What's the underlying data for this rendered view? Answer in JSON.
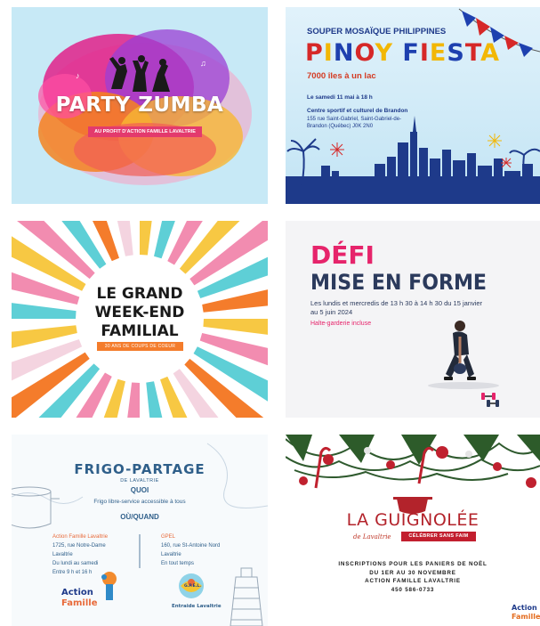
{
  "cards": {
    "party_zumba": {
      "title": "PARTY ZUMBA",
      "subtitle": "AU PROFIT D'ACTION FAMILLE LAVALTRIE"
    },
    "pinoy_fiesta": {
      "kicker": "SOUPER MOSAÏQUE PHILIPPINES",
      "title_letters": [
        "P",
        "I",
        "N",
        "O",
        "Y",
        " ",
        "F",
        "I",
        "E",
        "S",
        "T",
        "A"
      ],
      "title_colors": [
        "#d62828",
        "#f2b705",
        "#1e40af",
        "#d62828",
        "#f2b705",
        "#ffffff",
        "#1e40af",
        "#d62828",
        "#f2b705",
        "#1e40af",
        "#d62828",
        "#f2b705"
      ],
      "tagline": "7000 îles à un lac",
      "date": "Le samedi 11 mai à 18 h",
      "venue": "Centre sportif et culturel de Brandon",
      "address": "155 rue Saint-Gabriel, Saint-Gabriel-de-Brandon (Québec) J0K 2N0"
    },
    "grand_weekend": {
      "title_line1": "LE GRAND",
      "title_line2": "WEEK-END",
      "title_line3": "FAMILIAL",
      "subtitle": "30 ANS DE COUPS DE COEUR"
    },
    "defi": {
      "title_line1": "DÉFI",
      "title_line2": "MISE EN FORME",
      "schedule": "Les lundis et mercredis de 13 h 30 à 14 h 30 du 15 janvier au 5 juin 2024",
      "note": "Halte-garderie incluse"
    },
    "frigo": {
      "title": "FRIGO-PARTAGE",
      "subtitle": "DE LAVALTRIE",
      "quoi_label": "QUOI",
      "quoi_text": "Frigo libre-service accessible à tous",
      "ou_label": "OÙ/QUAND",
      "left_head": "Action Famille Lavaltrie",
      "left_l1": "1725, rue Notre-Dame",
      "left_l2": "Lavaltrie",
      "left_l3": "Du lundi au samedi",
      "left_l4": "Entre 9 h et 16 h",
      "right_head": "GPEL",
      "right_l1": "160, rue St-Antoine Nord",
      "right_l2": "Lavaltrie",
      "right_l3": "En tout temps",
      "logo1_a": "Action",
      "logo1_b": "Famille",
      "logo2_a": "G.P.E.L.",
      "logo2_b": "Entraide Lavaltrie"
    },
    "guignolee": {
      "title": "LA GUIGNOLÉE",
      "de": "de Lavaltrie",
      "badge": "CÉLÉBRER SANS FAIM",
      "info_l1": "INSCRIPTIONS POUR LES PANIERS DE NOËL",
      "info_l2": "DU 1ER AU 30 NOVEMBRE",
      "info_l3": "ACTION FAMILLE LAVALTRIE",
      "info_l4": "450 586-0733",
      "logo_a": "Action",
      "logo_b": "Famille"
    }
  }
}
